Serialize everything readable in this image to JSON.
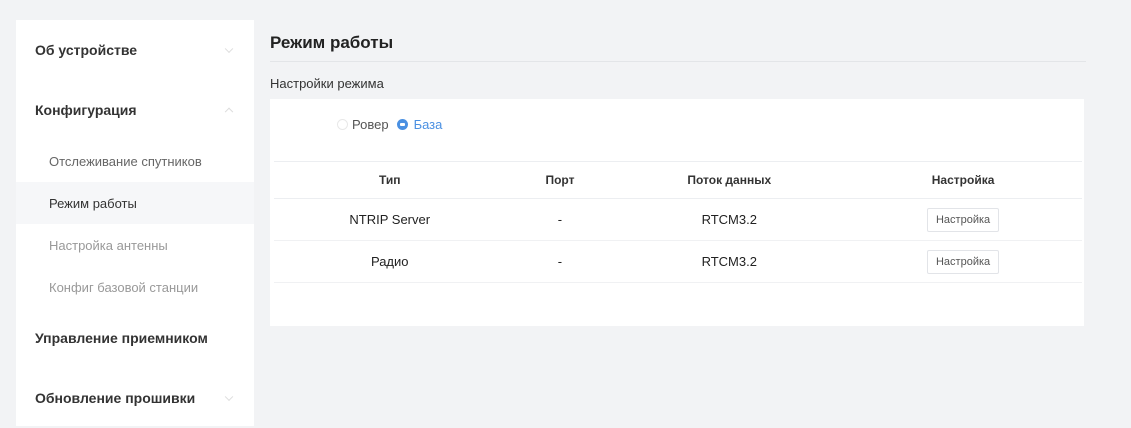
{
  "sidebar": {
    "about": "Об устройстве",
    "config": "Конфигурация",
    "config_items": [
      "Отслеживание спутников",
      "Режим работы",
      "Настройка антенны",
      "Конфиг базовой станции"
    ],
    "receiver": "Управление приемником",
    "firmware": "Обновление прошивки"
  },
  "main": {
    "title": "Режим работы",
    "section": "Настройки режима",
    "mode_options": {
      "rover": "Ровер",
      "base": "База",
      "selected": "База"
    },
    "table": {
      "headers": [
        "Тип",
        "Порт",
        "Поток данных",
        "Настройка"
      ],
      "rows": [
        {
          "type": "NTRIP Server",
          "port": "-",
          "stream": "RTCM3.2",
          "action": "Настройка"
        },
        {
          "type": "Радио",
          "port": "-",
          "stream": "RTCM3.2",
          "action": "Настройка"
        }
      ]
    }
  },
  "colors": {
    "accent": "#4a90e2",
    "page_bg": "#f2f3f5",
    "panel_bg": "#ffffff"
  }
}
